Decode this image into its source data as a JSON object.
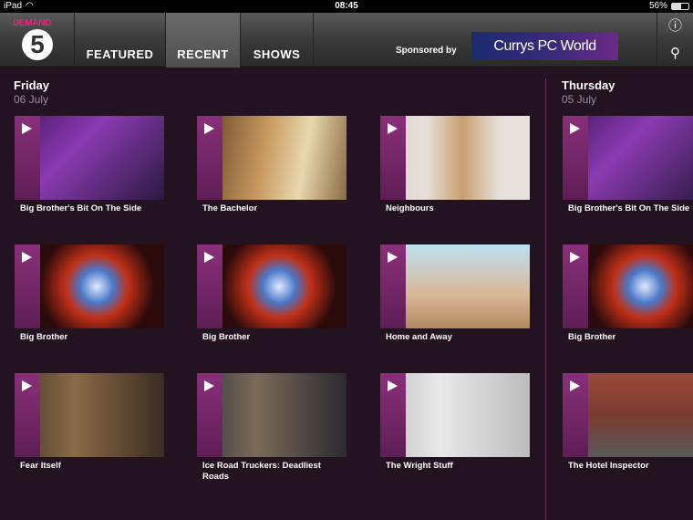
{
  "status": {
    "device": "iPad",
    "time": "08:45",
    "battery": "56%"
  },
  "nav": {
    "brand_word": "DEMAND",
    "brand_number": "5",
    "tabs": [
      {
        "label": "FEATURED",
        "active": false
      },
      {
        "label": "RECENT",
        "active": true
      },
      {
        "label": "SHOWS",
        "active": false
      }
    ],
    "sponsor_label": "Sponsored by",
    "sponsor_logo": "Currys PC World",
    "info_icon": "info-icon",
    "search_icon": "search-icon"
  },
  "days": [
    {
      "name": "Friday",
      "date": "06 July"
    },
    {
      "name": "Thursday",
      "date": "05 July"
    }
  ],
  "friday_cards": [
    {
      "title": "Big Brother's Bit On The Side"
    },
    {
      "title": "The Bachelor"
    },
    {
      "title": "Neighbours"
    },
    {
      "title": "Big Brother"
    },
    {
      "title": "Big Brother"
    },
    {
      "title": "Home and Away"
    },
    {
      "title": "Fear Itself"
    },
    {
      "title": "Ice Road Truckers: Deadliest Roads"
    },
    {
      "title": "The Wright Stuff"
    }
  ],
  "thursday_cards": [
    {
      "title": "Big Brother's Bit On The Side"
    },
    {
      "title": "Big Brother"
    },
    {
      "title": "The Hotel Inspector"
    }
  ],
  "colors": {
    "background": "#23121f",
    "accent": "#e0267c",
    "play_strip": "#8a2f7a"
  }
}
